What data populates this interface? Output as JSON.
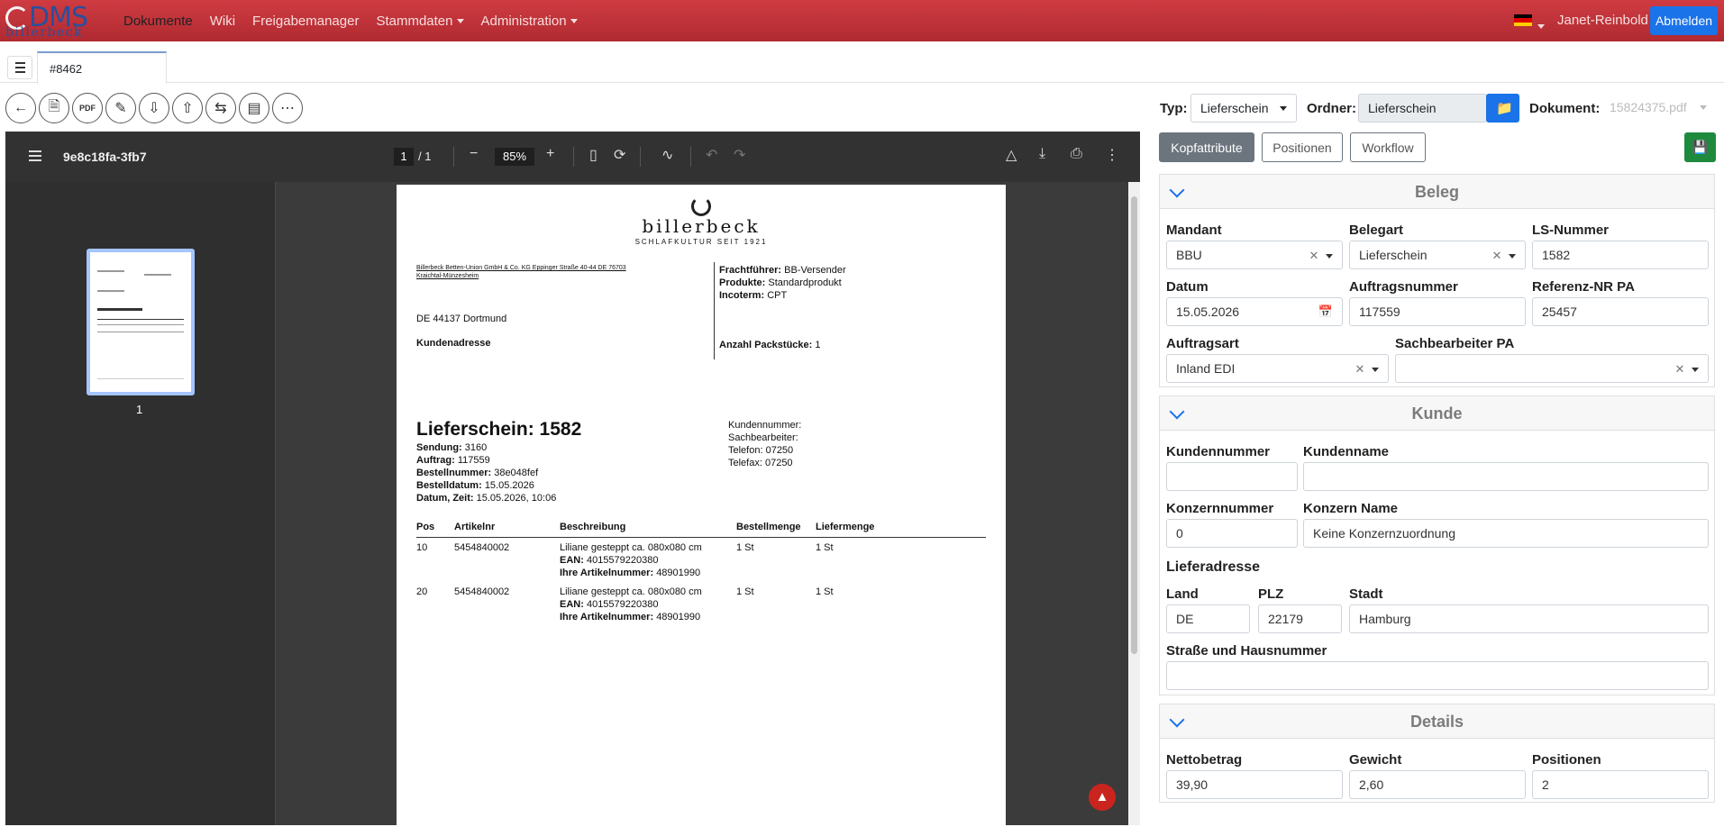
{
  "nav": {
    "logo_text": "DMS",
    "logo_sub": "billerbeck",
    "items": [
      "Dokumente",
      "Wiki",
      "Freigabemanager",
      "Stammdaten",
      "Administration"
    ],
    "user": "Janet-Reinbold",
    "logout": "Abmelden",
    "flag_colors": [
      "#000000",
      "#dd0000",
      "#ffce00"
    ]
  },
  "tab": {
    "label": "#8462"
  },
  "toolbar_icons": [
    "back-icon",
    "document-check-icon",
    "pdf-icon",
    "document-edit-icon",
    "document-download-icon",
    "upload-icon",
    "swap-icon",
    "book-icon",
    "more-icon"
  ],
  "viewer": {
    "title": "9e8c18fa-3fb7",
    "page": "1",
    "page_of": "/  1",
    "zoom": "85%",
    "thumb_label": "1"
  },
  "pdf": {
    "brand": "billerbeck",
    "tagline": "SCHLAFKULTUR SEIT 1921",
    "sender_line1": "Billerbeck Betten-Union GmbH & Co. KG  Eppinger Straße 40-44  DE 76703",
    "sender_line2": "Kraichtal-Münzesheim",
    "carrier_label": "Frachtführer:",
    "carrier": "BB-Versender",
    "products_label": "Produkte:",
    "products": "Standardprodukt",
    "incoterm_label": "Incoterm:",
    "incoterm": "CPT",
    "addr_city": "DE 44137 Dortmund",
    "addr_label": "Kundenadresse",
    "packages_label": "Anzahl Packstücke:",
    "packages": "1",
    "title": "Lieferschein: 1582",
    "meta": [
      {
        "k": "Sendung:",
        "v": "3160"
      },
      {
        "k": "Auftrag:",
        "v": "117559"
      },
      {
        "k": "Bestellnummer:",
        "v": "38e048fef"
      },
      {
        "k": "Bestelldatum:",
        "v": "15.05.2026"
      },
      {
        "k": "Datum, Zeit:",
        "v": "15.05.2026, 10:06"
      }
    ],
    "contact": [
      "Kundennummer:",
      "Sachbearbeiter:",
      "Telefon: 07250",
      "Telefax: 07250"
    ],
    "columns": [
      "Pos",
      "Artikelnr",
      "Beschreibung",
      "Bestellmenge",
      "Liefermenge"
    ],
    "rows": [
      {
        "pos": "10",
        "art": "5454840002",
        "desc": "Liliane gesteppt ca. 080x080 cm",
        "ean_label": "EAN:",
        "ean": "4015579220380",
        "ref_label": "Ihre Artikelnummer:",
        "ref": "48901990",
        "best": "1 St",
        "lief": "1 St"
      },
      {
        "pos": "20",
        "art": "5454840002",
        "desc": "Liliane gesteppt ca. 080x080 cm",
        "ean_label": "EAN:",
        "ean": "4015579220380",
        "ref_label": "Ihre Artikelnummer:",
        "ref": "48901990",
        "best": "1 St",
        "lief": "1 St"
      }
    ]
  },
  "form": {
    "typ_label": "Typ:",
    "typ": "Lieferschein",
    "ordner_label": "Ordner:",
    "ordner": "Lieferschein",
    "dokument_label": "Dokument:",
    "dokument": "15824375.pdf",
    "tabs": [
      "Kopfattribute",
      "Positionen",
      "Workflow"
    ],
    "beleg": {
      "title": "Beleg",
      "mandant_label": "Mandant",
      "mandant": "BBU",
      "belegart_label": "Belegart",
      "belegart": "Lieferschein",
      "ls_label": "LS-Nummer",
      "ls": "1582",
      "datum_label": "Datum",
      "datum": "15.05.2026",
      "auftrag_label": "Auftragsnummer",
      "auftrag": "117559",
      "referenz_label": "Referenz-NR PA",
      "referenz": "25457",
      "auftragsart_label": "Auftragsart",
      "auftragsart": "Inland EDI",
      "sachbearbeiter_label": "Sachbearbeiter PA",
      "sachbearbeiter": ""
    },
    "kunde": {
      "title": "Kunde",
      "kundennummer_label": "Kundennummer",
      "kundennummer": "",
      "kundenname_label": "Kundenname",
      "kundenname": "",
      "konzernnummer_label": "Konzernnummer",
      "konzernnummer": "0",
      "konzernname_label": "Konzern Name",
      "konzernname": "Keine Konzernzuordnung",
      "lieferadresse": "Lieferadresse",
      "land_label": "Land",
      "land": "DE",
      "plz_label": "PLZ",
      "plz": "22179",
      "stadt_label": "Stadt",
      "stadt": "Hamburg",
      "strasse_label": "Straße und Hausnummer",
      "strasse": ""
    },
    "details": {
      "title": "Details",
      "netto_label": "Nettobetrag",
      "netto": "39,90",
      "gewicht_label": "Gewicht",
      "gewicht": "2,60",
      "positionen_label": "Positionen",
      "positionen": "2"
    }
  }
}
